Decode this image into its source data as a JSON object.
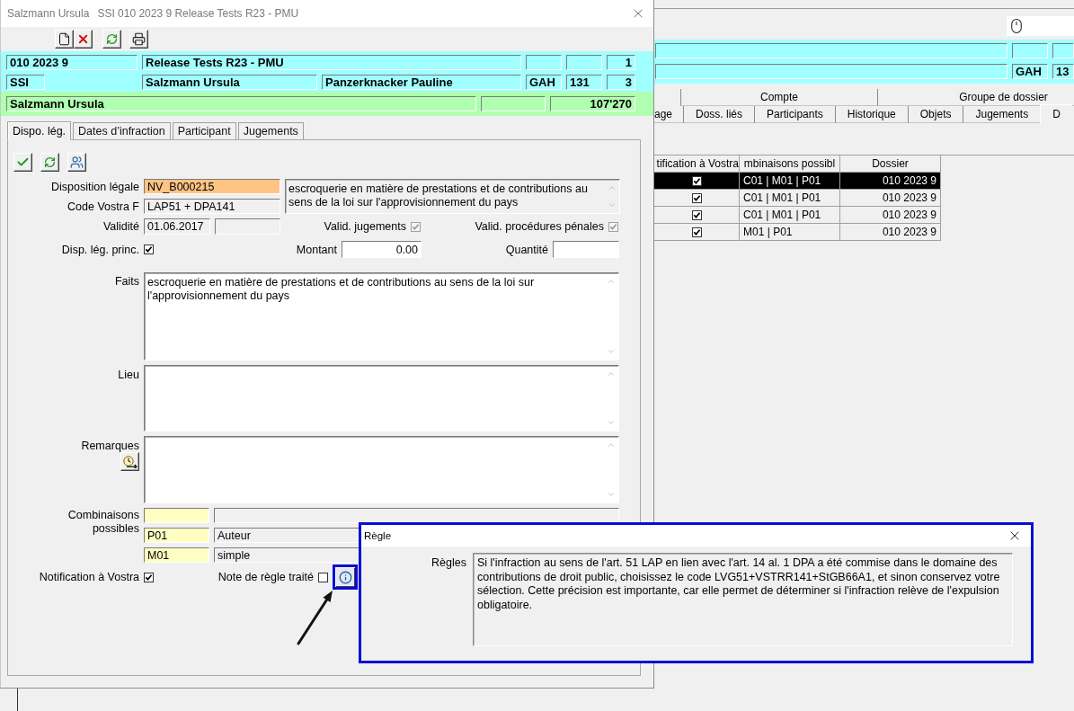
{
  "dialog": {
    "title": [
      "Salzmann Ursula",
      "SSI 010 2023 9 Release Tests R23 - PMU"
    ],
    "case_bar": {
      "row_1": {
        "field_1": "010 2023 9",
        "field_2": "Release Tests R23 - PMU",
        "field_5": "1"
      },
      "row_2": {
        "field_1": "SSI",
        "field_2": "Salzmann Ursula",
        "field_3": "Panzerknacker Pauline",
        "field_4": "GAH",
        "field_5": "131",
        "field_6": "3"
      }
    },
    "person_bar": {
      "field_1": "Salzmann Ursula",
      "field_3": "107'270"
    },
    "tabs": [
      {
        "label": "Dispo. lég.",
        "selected": true
      },
      {
        "label": "Dates d’infraction",
        "selected": false
      },
      {
        "label": "Participant",
        "selected": false
      },
      {
        "label": "Jugements",
        "selected": false
      }
    ],
    "form": {
      "legal_provision": {
        "label": "Disposition légale",
        "value": "NV_B000215",
        "description": "escroquerie en matière de prestations et de contributions au sens de la loi sur l'approvisionnement du pays"
      },
      "vostra_code": {
        "label": "Code Vostra F",
        "value": "LAP51 + DPA141"
      },
      "validity": {
        "label": "Validité",
        "value": "01.06.2017"
      },
      "valid_judgments": {
        "label": "Valid. jugements",
        "checked": true,
        "disabled": true
      },
      "valid_proceedings": {
        "label": "Valid. procédures pénales",
        "checked": true,
        "disabled": true
      },
      "main_provision": {
        "label": "Disp. lég. princ.",
        "checked": true,
        "disabled": false
      },
      "amount": {
        "label": "Montant",
        "value": "0.00"
      },
      "quantity": {
        "label": "Quantité"
      },
      "facts": {
        "label": "Faits",
        "value": "escroquerie en matière de prestations et de contributions au sens de la loi sur l'approvisionnement du pays"
      },
      "place": {
        "label": "Lieu"
      },
      "remarks": {
        "label": "Remarques"
      },
      "combinations": {
        "label": "Combinaisons possibles",
        "rows": [
          {
            "code": "P01",
            "name": "Auteur"
          },
          {
            "code": "M01",
            "name": "simple"
          }
        ]
      },
      "vostra_notification": {
        "label": "Notification à Vostra",
        "checked": true,
        "disabled": false
      },
      "rule_note_done": {
        "label": "Note de règle traité",
        "checked": false,
        "disabled": false
      }
    }
  },
  "background_window": {
    "case_bar": {
      "row_2": {
        "field_2": "GAH",
        "field_3": "13"
      }
    },
    "tab_rows": [
      {
        "tabs": [
          {
            "label": "Compte",
            "selected": false
          },
          {
            "label": "Groupe de dossier",
            "selected": false
          }
        ]
      },
      {
        "tabs": [
          {
            "label": "age",
            "selected": false
          },
          {
            "label": "Doss. liés",
            "selected": false
          },
          {
            "label": "Participants",
            "selected": false
          },
          {
            "label": "Historique",
            "selected": false
          },
          {
            "label": "Objets",
            "selected": false
          },
          {
            "label": "Jugements",
            "selected": false
          },
          {
            "label": "D",
            "selected": true
          }
        ]
      }
    ],
    "table": {
      "columns": [
        "tification à Vostra",
        "mbinaisons possibl",
        "Dossier"
      ],
      "rows": [
        {
          "column_1": {
            "checked": true
          },
          "column_2": "C01 | M01 | P01",
          "dossier": "010 2023 9",
          "selected": true
        },
        {
          "column_1": {
            "checked": true
          },
          "column_2": "C01 | M01 | P01",
          "dossier": "010 2023 9",
          "selected": false
        },
        {
          "column_1": {
            "checked": true
          },
          "column_2": "C01 | M01 | P01",
          "dossier": "010 2023 9",
          "selected": false
        },
        {
          "column_1": {
            "checked": true
          },
          "column_2": "M01 | P01",
          "dossier": "010 2023 9",
          "selected": false
        }
      ]
    }
  },
  "rule_dialog": {
    "title": "Règle",
    "label": "Règles",
    "text": "Si l'infraction au sens de l'art. 51 LAP en lien avec l'art. 14 al. 1 DPA a été commise dans le domaine des contributions de droit public, choisissez le code LVG51+VSTRR141+StGB66A1, et sinon conservez votre\nsélection. Cette précision est importante, car elle permet de déterminer si l'infraction relève de l'expulsion obligatoire."
  }
}
